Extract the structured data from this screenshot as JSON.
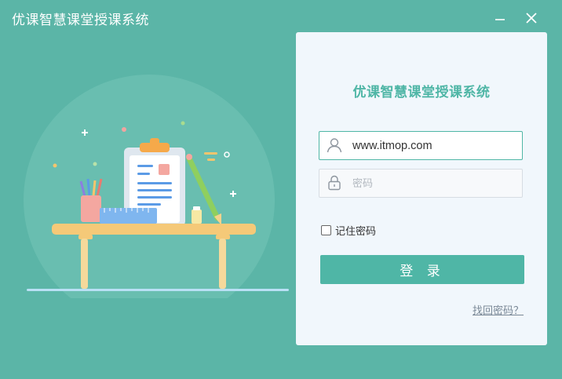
{
  "window": {
    "title": "优课智慧课堂授课系统",
    "minimize_icon": "minimize-icon",
    "close_icon": "close-icon"
  },
  "colors": {
    "background": "#5bb5a7",
    "accent": "#4fb6a6",
    "panel": "#f1f7fc"
  },
  "login": {
    "title": "优课智慧课堂授课系统",
    "username": {
      "icon": "user-icon",
      "value": "www.itmop.com"
    },
    "password": {
      "icon": "lock-icon",
      "placeholder": "密码"
    },
    "remember_label": "记住密码",
    "remember_checked": false,
    "login_button": "登 录",
    "forgot_link": "找回密码？"
  },
  "illustration": {
    "subject": "desk-with-clipboard-pencils-ruler"
  }
}
